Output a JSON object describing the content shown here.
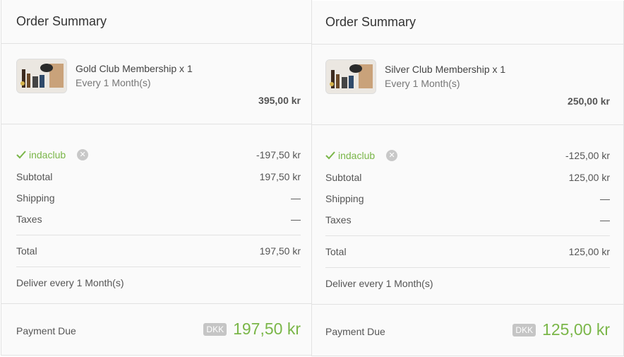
{
  "panels": [
    {
      "title": "Order Summary",
      "item": {
        "name": "Gold Club Membership x 1",
        "frequency": "Every 1 Month(s)",
        "price": "395,00 kr"
      },
      "discount": {
        "code": "indaclub",
        "amount": "-197,50 kr"
      },
      "subtotal": {
        "label": "Subtotal",
        "value": "197,50 kr"
      },
      "shipping": {
        "label": "Shipping",
        "value": "—"
      },
      "taxes": {
        "label": "Taxes",
        "value": "—"
      },
      "total": {
        "label": "Total",
        "value": "197,50 kr"
      },
      "delivery": "Deliver every 1 Month(s)",
      "payment_due": {
        "label": "Payment Due",
        "currency": "DKK",
        "amount": "197,50 kr"
      }
    },
    {
      "title": "Order Summary",
      "item": {
        "name": "Silver Club Membership x 1",
        "frequency": "Every 1 Month(s)",
        "price": "250,00 kr"
      },
      "discount": {
        "code": "indaclub",
        "amount": "-125,00 kr"
      },
      "subtotal": {
        "label": "Subtotal",
        "value": "125,00 kr"
      },
      "shipping": {
        "label": "Shipping",
        "value": "—"
      },
      "taxes": {
        "label": "Taxes",
        "value": "—"
      },
      "total": {
        "label": "Total",
        "value": "125,00 kr"
      },
      "delivery": "Deliver every 1 Month(s)",
      "payment_due": {
        "label": "Payment Due",
        "currency": "DKK",
        "amount": "125,00 kr"
      }
    }
  ],
  "colors": {
    "accent": "#7ab648",
    "badge": "#c5c5c5",
    "border": "#e2e2e2"
  }
}
